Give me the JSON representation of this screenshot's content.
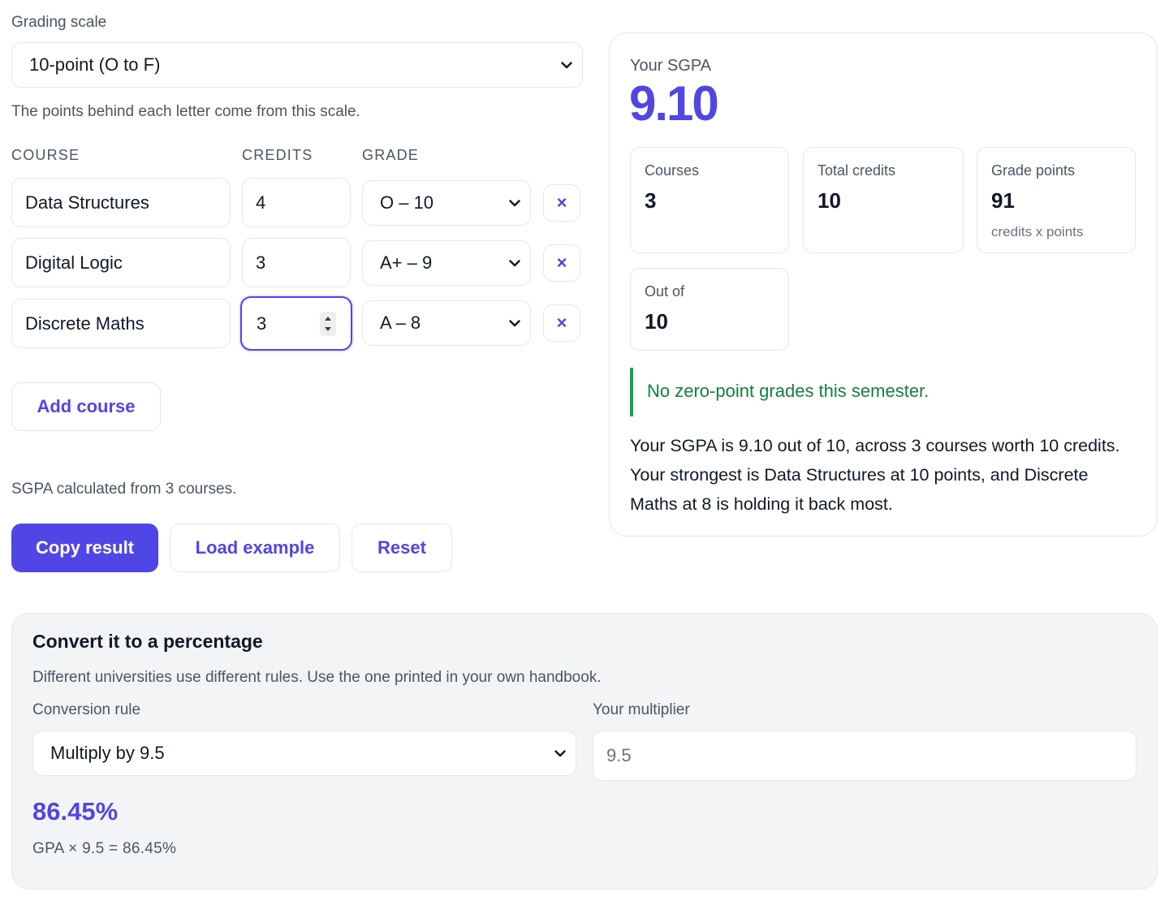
{
  "grading": {
    "label": "Grading scale",
    "selected": "10-point (O to F)",
    "helper": "The points behind each letter come from this scale."
  },
  "table": {
    "headers": {
      "course": "COURSE",
      "credits": "CREDITS",
      "grade": "GRADE"
    },
    "rows": [
      {
        "course": "Data Structures",
        "credits": "4",
        "grade": "O – 10"
      },
      {
        "course": "Digital Logic",
        "credits": "3",
        "grade": "A+ – 9"
      },
      {
        "course": "Discrete Maths",
        "credits": "3",
        "grade": "A – 8"
      }
    ],
    "remove_glyph": "×"
  },
  "add_course_label": "Add course",
  "calc_note": "SGPA calculated from 3 courses.",
  "actions": {
    "copy": "Copy result",
    "load": "Load example",
    "reset": "Reset"
  },
  "result": {
    "title": "Your SGPA",
    "value": "9.10",
    "stats": {
      "courses": {
        "label": "Courses",
        "value": "3"
      },
      "credits": {
        "label": "Total credits",
        "value": "10"
      },
      "points": {
        "label": "Grade points",
        "value": "91",
        "sub": "credits x points"
      },
      "outof": {
        "label": "Out of",
        "value": "10"
      }
    },
    "notice": "No zero-point grades this semester.",
    "summary_1": "Your SGPA is 9.10 out of 10, across 3 courses worth 10 credits.",
    "summary_2": "Your strongest is Data Structures at 10 points, and Discrete",
    "summary_3": "Maths at 8 is holding it back most."
  },
  "convert": {
    "title": "Convert it to a percentage",
    "desc": "Different universities use different rules. Use the one printed in your own handbook.",
    "rule_label": "Conversion rule",
    "rule_selected": "Multiply by 9.5",
    "mult_label": "Your multiplier",
    "mult_value": "9.5",
    "percent": "86.45%",
    "formula": "GPA × 9.5 = 86.45%"
  },
  "colors": {
    "accent": "#4f46e5",
    "success": "#15803d",
    "success_bar": "#16a34a",
    "border": "#e5e7eb"
  },
  "icons": [
    "chevron-down-icon",
    "close-icon",
    "stepper-icon"
  ]
}
